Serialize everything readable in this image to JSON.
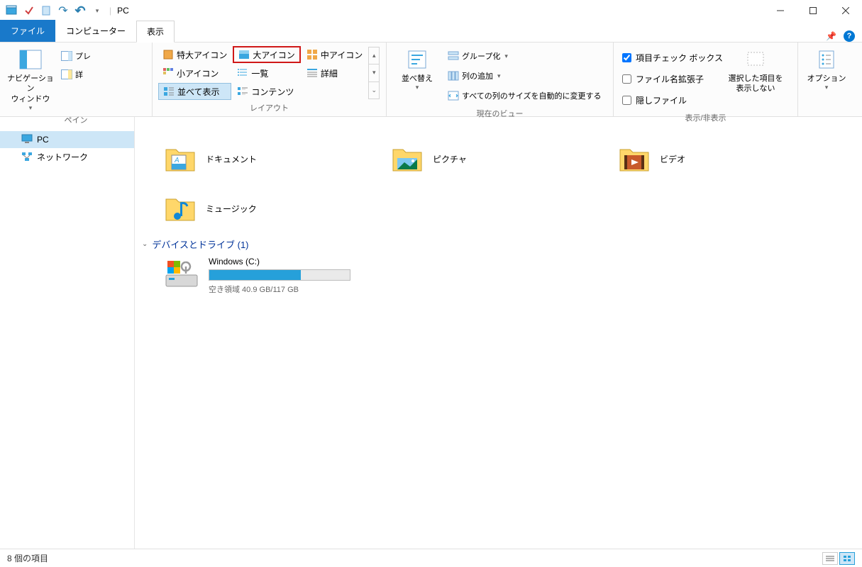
{
  "window": {
    "title": "PC"
  },
  "tabs": {
    "file": "ファイル",
    "computer": "コンピューター",
    "view": "表示"
  },
  "ribbon": {
    "pane": {
      "nav": "ナビゲーション\nウィンドウ",
      "preview": "プレ",
      "details": "詳",
      "label": "ペイン"
    },
    "layout": {
      "extra_large": "特大アイコン",
      "large": "大アイコン",
      "medium": "中アイコン",
      "small": "小アイコン",
      "list": "一覧",
      "details": "詳細",
      "tiles": "並べて表示",
      "content": "コンテンツ",
      "label": "レイアウト"
    },
    "current_view": {
      "sort": "並べ替え",
      "group": "グループ化",
      "add_cols": "列の追加",
      "autosize": "すべての列のサイズを自動的に変更する",
      "label": "現在のビュー"
    },
    "showhide": {
      "checkboxes": "項目チェック ボックス",
      "extensions": "ファイル名拡張子",
      "hidden": "隠しファイル",
      "hide_selected": "選択した項目を\n表示しない",
      "label": "表示/非表示"
    },
    "options": "オプション"
  },
  "sidebar": {
    "pc": "PC",
    "network": "ネットワーク"
  },
  "main": {
    "folders": {
      "documents": "ドキュメント",
      "pictures": "ピクチャ",
      "videos": "ビデオ",
      "music": "ミュージック"
    },
    "devices_header": "デバイスとドライブ (1)",
    "drive": {
      "name": "Windows (C:)",
      "free_text": "空き領域 40.9 GB/117 GB",
      "used_percent": 65
    }
  },
  "status": {
    "items": "8 個の項目"
  }
}
